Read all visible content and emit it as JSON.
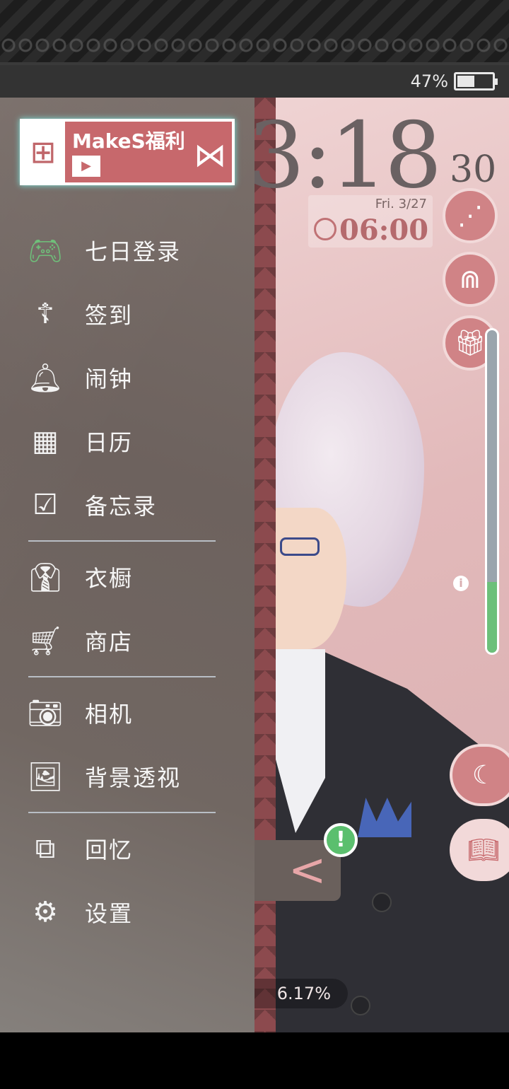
{
  "statusbar": {
    "battery_text": "47%",
    "battery_level": 0.47
  },
  "scene": {
    "clock_hm": "3:18",
    "clock_sec": "30",
    "date": "Fri.  3/27",
    "alarm_time": "06:00",
    "progress_text": "6.17%",
    "gauge_level": 0.22
  },
  "drawer": {
    "banner": {
      "title": "MakeS福利",
      "play_symbol": "▶"
    },
    "items": [
      {
        "label": "七日登录",
        "icon": "gamepad-check-icon"
      },
      {
        "label": "签到",
        "icon": "scarecrow-icon"
      },
      {
        "label": "闹钟",
        "icon": "alarm-bell-icon"
      },
      {
        "label": "日历",
        "icon": "calendar-icon"
      },
      {
        "label": "备忘录",
        "icon": "checklist-icon"
      },
      {
        "label": "衣橱",
        "icon": "shirt-icon"
      },
      {
        "label": "商店",
        "icon": "cart-icon"
      },
      {
        "label": "相机",
        "icon": "camera-icon"
      },
      {
        "label": "背景透视",
        "icon": "image-icon"
      },
      {
        "label": "回忆",
        "icon": "memories-icon"
      },
      {
        "label": "设置",
        "icon": "gear-icon"
      }
    ]
  },
  "handle": {
    "badge": "!",
    "arrow": "<"
  },
  "colors": {
    "accent": "#c7686c",
    "drawer_bg": "#6d625e",
    "scene_bg": "#e2b9ba",
    "badge_green": "#5bbf6e"
  }
}
